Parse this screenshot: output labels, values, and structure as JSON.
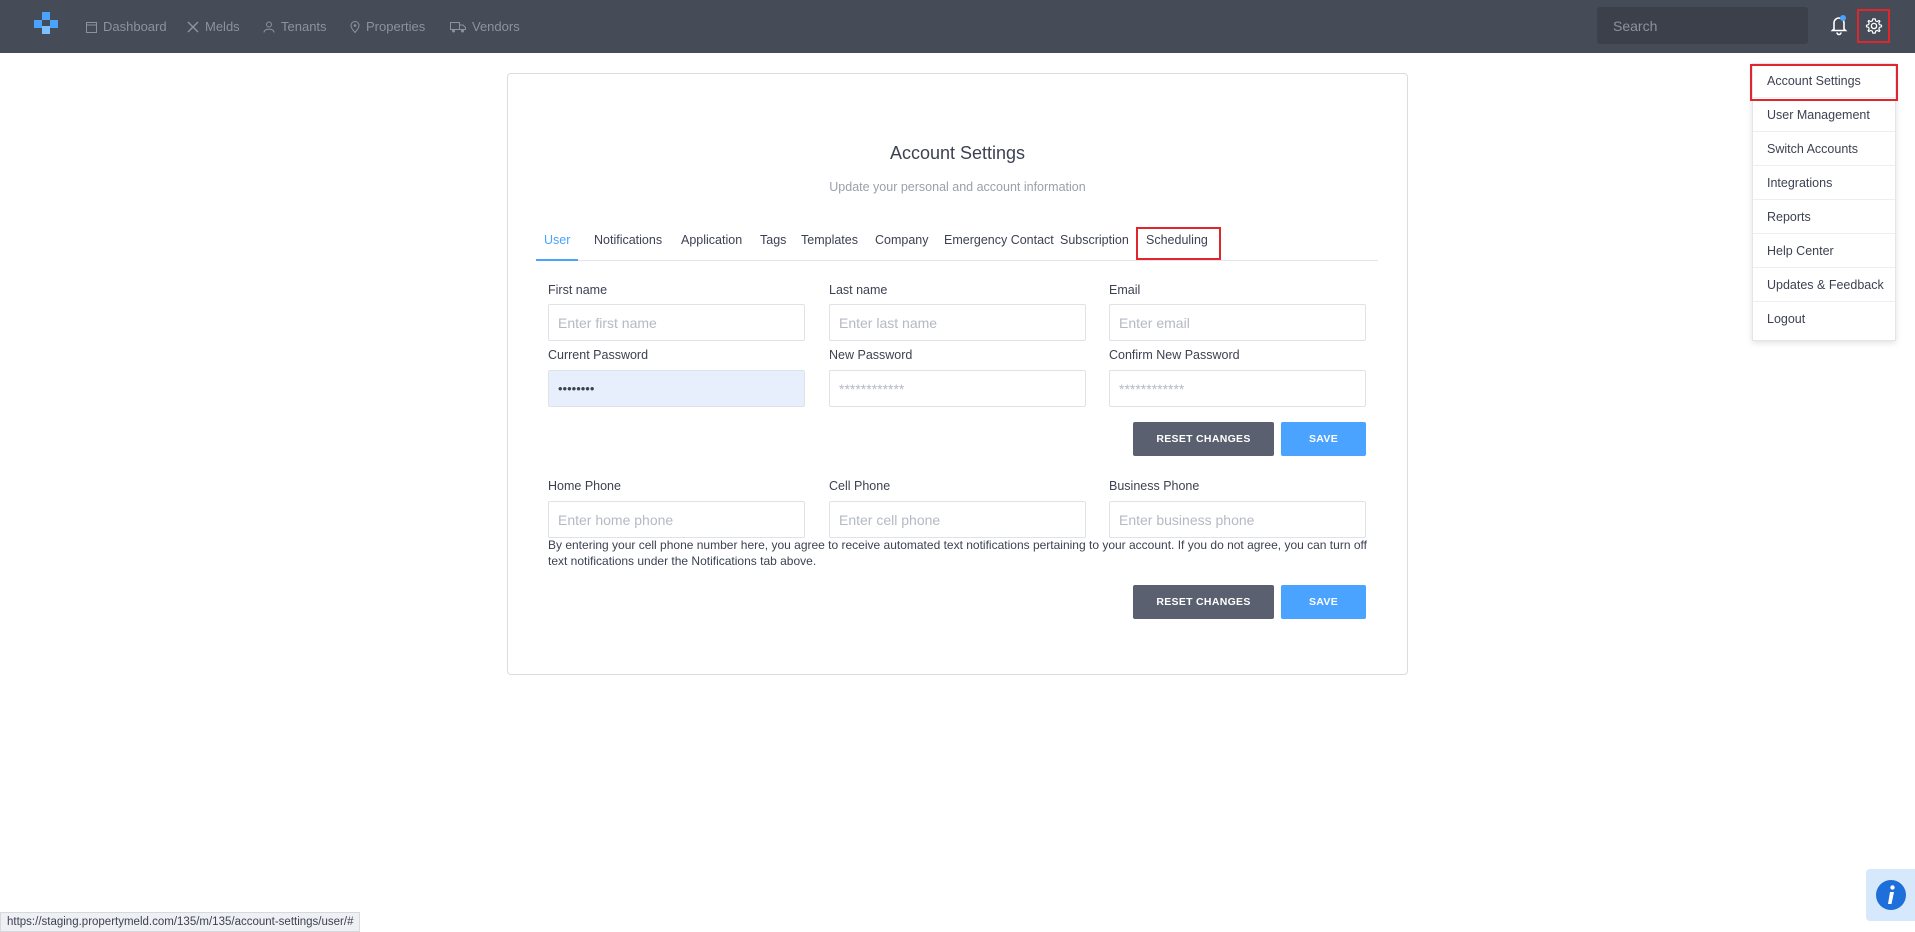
{
  "nav": {
    "items": [
      {
        "label": "Dashboard",
        "icon": "calendar-icon"
      },
      {
        "label": "Melds",
        "icon": "tools-icon"
      },
      {
        "label": "Tenants",
        "icon": "person-icon"
      },
      {
        "label": "Properties",
        "icon": "pin-icon"
      },
      {
        "label": "Vendors",
        "icon": "truck-icon"
      }
    ],
    "search_placeholder": "Search"
  },
  "settings_menu": {
    "items": [
      "Account Settings",
      "User Management",
      "Switch Accounts",
      "Integrations",
      "Reports",
      "Help Center",
      "Updates & Feedback",
      "Logout"
    ]
  },
  "page": {
    "title": "Account Settings",
    "subtitle": "Update your personal and account information",
    "tabs": [
      "User",
      "Notifications",
      "Application",
      "Tags",
      "Templates",
      "Company",
      "Emergency Contact",
      "Subscription",
      "Scheduling"
    ],
    "active_tab": "User"
  },
  "form": {
    "first_name": {
      "label": "First name",
      "placeholder": "Enter first name"
    },
    "last_name": {
      "label": "Last name",
      "placeholder": "Enter last name"
    },
    "email": {
      "label": "Email",
      "placeholder": "Enter email"
    },
    "current_password": {
      "label": "Current Password",
      "value": "••••••••"
    },
    "new_password": {
      "label": "New Password",
      "placeholder": "************"
    },
    "confirm_password": {
      "label": "Confirm New Password",
      "placeholder": "************"
    },
    "home_phone": {
      "label": "Home Phone",
      "placeholder": "Enter home phone"
    },
    "cell_phone": {
      "label": "Cell Phone",
      "placeholder": "Enter cell phone"
    },
    "business_phone": {
      "label": "Business Phone",
      "placeholder": "Enter business phone"
    },
    "sms_note": "By entering your cell phone number here, you agree to receive automated text notifications pertaining to your account. If you do not agree, you can turn off text notifications under the Notifications tab above.",
    "reset_label": "RESET CHANGES",
    "save_label": "SAVE"
  },
  "status_url": "https://staging.propertymeld.com/135/m/135/account-settings/user/#",
  "colors": {
    "accent": "#4aa3ff",
    "nav_bg": "#454b57",
    "highlight": "#e0262d"
  }
}
